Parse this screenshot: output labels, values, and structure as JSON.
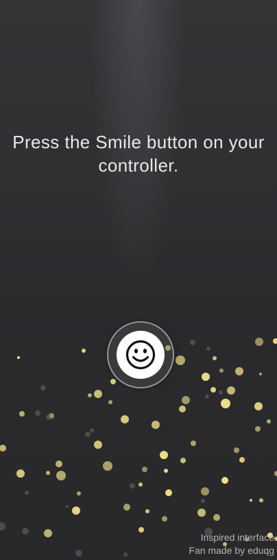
{
  "prompt": {
    "line1": "Press the Smile button on your",
    "line2": "controller."
  },
  "button": {
    "icon": "smile-icon"
  },
  "credits": {
    "line1": "Inspired interface",
    "line2": "Fan made by eduqg"
  },
  "colors": {
    "background": "#2b2b2e",
    "particle": "#f5e58a",
    "particle_dim": "#6a6a60",
    "text": "#e8e8ea"
  }
}
